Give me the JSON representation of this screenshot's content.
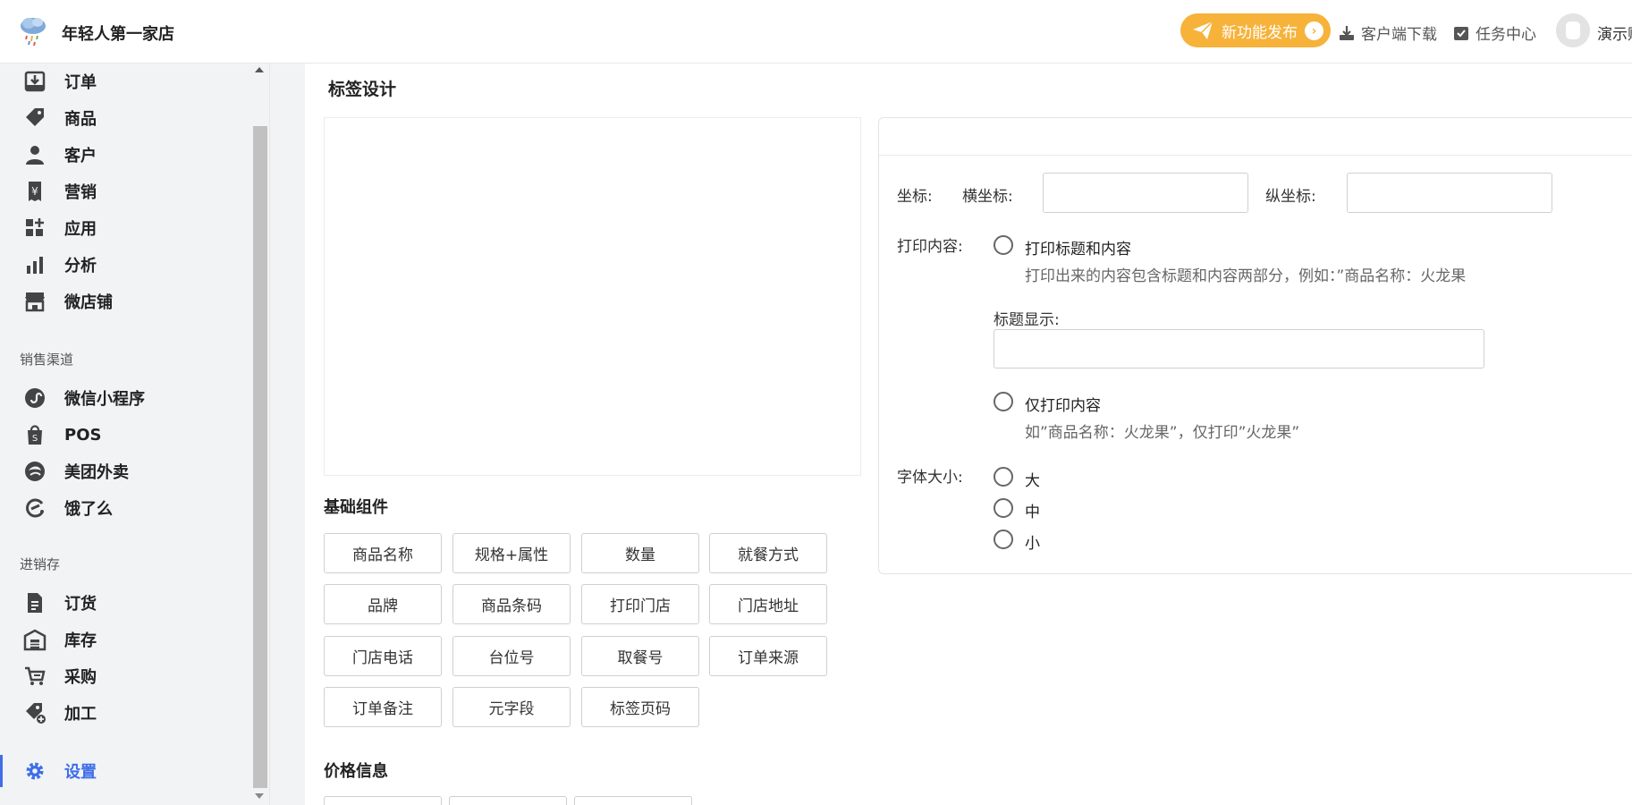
{
  "header": {
    "shop_name": "年轻人第一家店",
    "release_label": "新功能发布",
    "download_label": "客户端下载",
    "task_label": "任务中心",
    "user_name": "演示账号"
  },
  "sidebar": {
    "main_items": [
      {
        "label": "订单",
        "icon": "inbox-download-icon"
      },
      {
        "label": "商品",
        "icon": "tag-icon"
      },
      {
        "label": "客户",
        "icon": "user-icon"
      },
      {
        "label": "营销",
        "icon": "yen-receipt-icon"
      },
      {
        "label": "应用",
        "icon": "apps-grid-icon"
      },
      {
        "label": "分析",
        "icon": "bar-chart-icon"
      },
      {
        "label": "微店铺",
        "icon": "storefront-icon"
      }
    ],
    "channel_group": "销售渠道",
    "channel_items": [
      {
        "label": "微信小程序",
        "icon": "mini-program-icon"
      },
      {
        "label": "POS",
        "icon": "shopping-bag-icon"
      },
      {
        "label": "美团外卖",
        "icon": "meituan-icon"
      },
      {
        "label": "饿了么",
        "icon": "eleme-icon"
      }
    ],
    "inventory_group": "进销存",
    "inventory_items": [
      {
        "label": "订货",
        "icon": "document-icon"
      },
      {
        "label": "库存",
        "icon": "warehouse-icon"
      },
      {
        "label": "采购",
        "icon": "cart-icon"
      },
      {
        "label": "加工",
        "icon": "tag-plus-icon"
      }
    ],
    "settings_label": "设置",
    "accent_color": "#3f6ee8"
  },
  "main": {
    "page_title": "标签设计",
    "basic_section": "基础组件",
    "basic_components": [
      "商品名称",
      "规格+属性",
      "数量",
      "就餐方式",
      "品牌",
      "商品条码",
      "打印门店",
      "门店地址",
      "门店电话",
      "台位号",
      "取餐号",
      "订单来源",
      "订单备注",
      "元字段",
      "标签页码"
    ],
    "price_section": "价格信息"
  },
  "panel": {
    "coord_label": "坐标:",
    "x_label": "横坐标:",
    "y_label": "纵坐标:",
    "x_value": "",
    "y_value": "",
    "print_content_label": "打印内容:",
    "opt_title_content": "打印标题和内容",
    "opt_title_content_hint": "打印出来的内容包含标题和内容两部分，例如：”商品名称：火龙果",
    "title_display_label": "标题显示:",
    "title_display_value": "",
    "opt_content_only": "仅打印内容",
    "opt_content_only_hint": "如”商品名称：火龙果”，仅打印”火龙果”",
    "font_size_label": "字体大小:",
    "font_sizes": [
      "大",
      "中",
      "小"
    ]
  }
}
